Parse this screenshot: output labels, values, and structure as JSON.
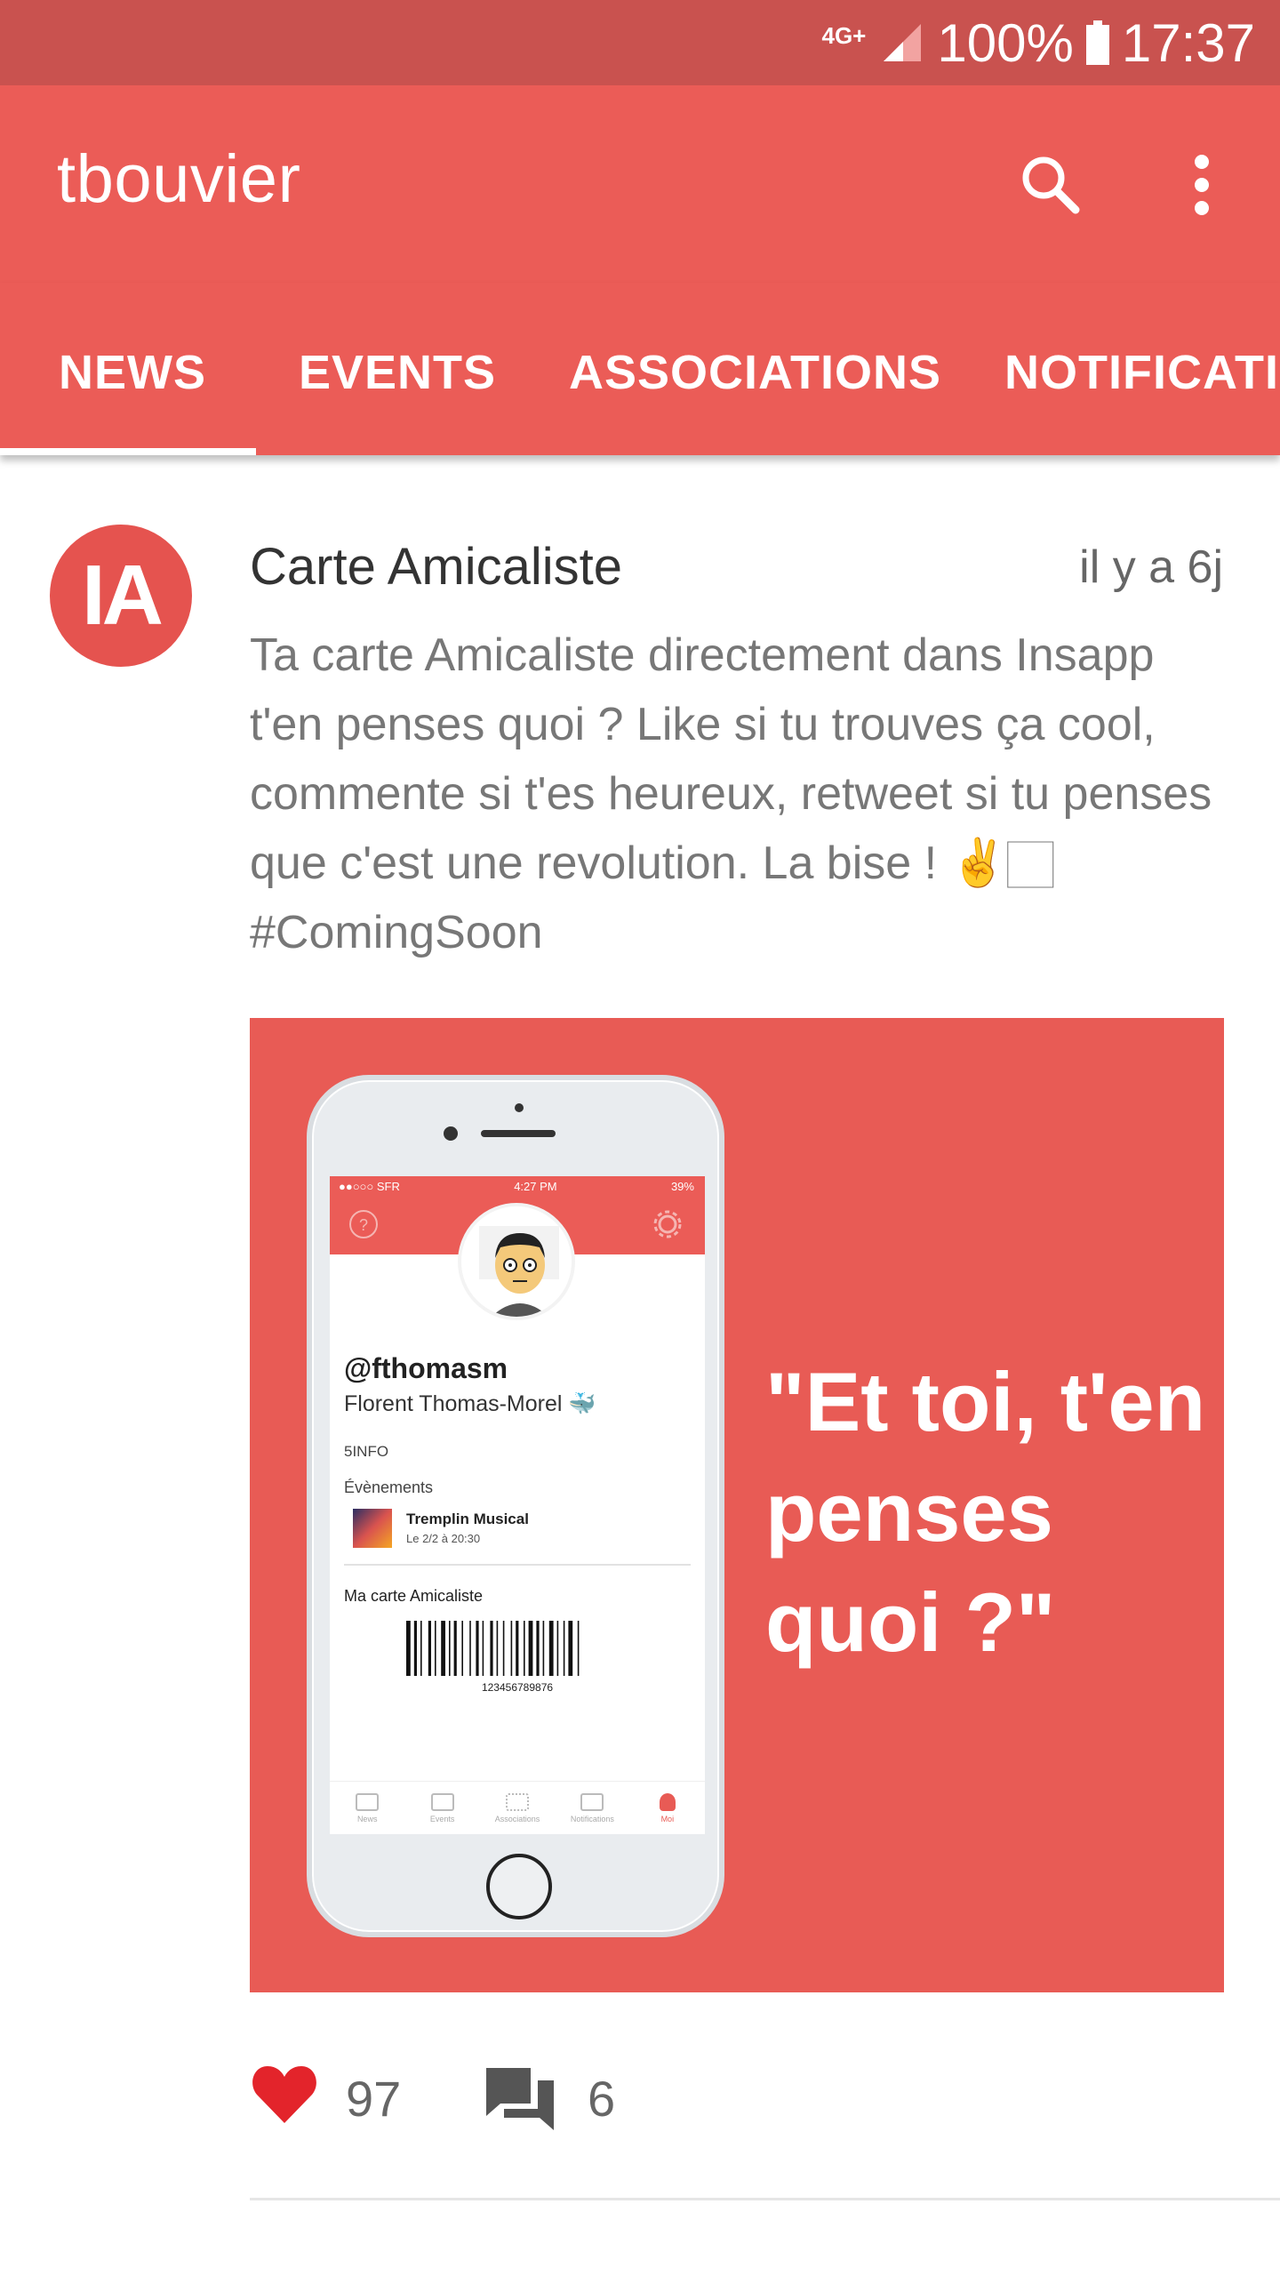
{
  "status_bar": {
    "network": "4G+",
    "battery": "100%",
    "time": "17:37",
    "bg_color": "#c9524f"
  },
  "app_bar": {
    "title": "tbouvier",
    "search_icon": "search-icon",
    "more_icon": "more-vert-icon",
    "bg_color": "#eb5c57"
  },
  "tabs": [
    {
      "label": "NEWS",
      "active": true
    },
    {
      "label": "EVENTS",
      "active": false
    },
    {
      "label": "ASSOCIATIONS",
      "active": false
    },
    {
      "label": "NOTIFICATIONS",
      "active": false
    }
  ],
  "post": {
    "avatar_text": "IA",
    "title": "Carte Amicaliste",
    "time": "il y a 6j",
    "text": "Ta carte Amicaliste directement dans Insapp t'en penses quoi ? Like si tu trouves ça cool, commente si t'es heureux, retweet si tu penses que c'est une revolution. La bise ! ✌️🏻#ComingSoon",
    "image": {
      "quote": "\"Et toi, t'en penses quoi ?\"",
      "phone": {
        "status_carrier": "●●○○○ SFR",
        "status_time": "4:27 PM",
        "status_battery": "39%",
        "handle": "@fthomasm",
        "fullname": "Florent Thomas-Morel 🐳",
        "department": "5INFO",
        "events_heading": "Évènements",
        "event_title": "Tremplin Musical",
        "event_date": "Le 2/2 à 20:30",
        "card_heading": "Ma carte Amicaliste",
        "barcode_number": "123456789876",
        "nav": [
          "News",
          "Events",
          "Associations",
          "Notifications",
          "Moi"
        ]
      }
    },
    "likes": "97",
    "comments": "6",
    "like_color": "#e3242b"
  }
}
